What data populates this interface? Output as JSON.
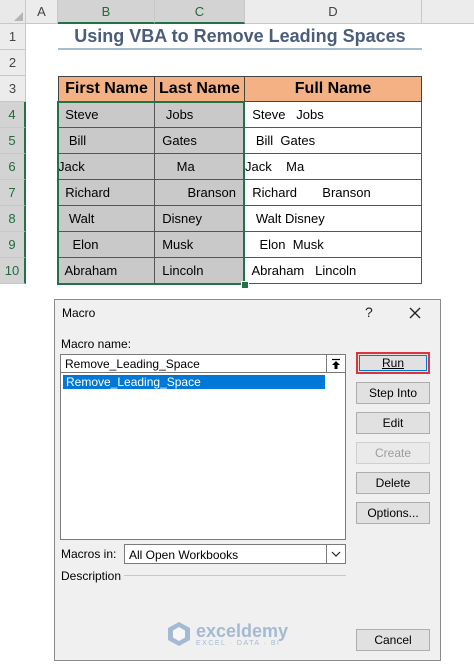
{
  "sheet": {
    "columns": [
      "A",
      "B",
      "C",
      "D"
    ],
    "rows": [
      "1",
      "2",
      "3",
      "4",
      "5",
      "6",
      "7",
      "8",
      "9",
      "10"
    ],
    "title": "Using VBA to Remove Leading Spaces",
    "headers": {
      "first": "First Name",
      "last": "Last Name",
      "full": "Full Name"
    },
    "data": [
      {
        "first": "  Steve",
        "last": "   Jobs",
        "full": "  Steve   Jobs"
      },
      {
        "first": "   Bill",
        "last": "  Gates",
        "full": "   Bill  Gates"
      },
      {
        "first": "Jack",
        "last": "      Ma",
        "full": "Jack    Ma"
      },
      {
        "first": "  Richard",
        "last": "         Branson",
        "full": "  Richard       Branson"
      },
      {
        "first": "   Walt",
        "last": "  Disney",
        "full": "   Walt Disney"
      },
      {
        "first": "    Elon",
        "last": "  Musk",
        "full": "    Elon  Musk"
      },
      {
        "first": "  Abraham",
        "last": "  Lincoln",
        "full": "  Abraham   Lincoln"
      }
    ]
  },
  "dialog": {
    "title": "Macro",
    "help": "?",
    "macro_name_label": "Macro name:",
    "macro_name_value": "Remove_Leading_Space",
    "macros": [
      "Remove_Leading_Space"
    ],
    "buttons": {
      "run": "Run",
      "step_into": "Step Into",
      "edit": "Edit",
      "create": "Create",
      "delete": "Delete",
      "options": "Options...",
      "cancel": "Cancel"
    },
    "macros_in_label": "Macros in:",
    "macros_in_value": "All Open Workbooks",
    "description_label": "Description"
  },
  "watermark": {
    "name": "exceldemy",
    "tagline": "EXCEL · DATA · BI"
  },
  "colors": {
    "header_fill": "#f4b183",
    "selection": "#217346",
    "run_highlight": "#d9363e",
    "list_selection": "#0078d7"
  }
}
